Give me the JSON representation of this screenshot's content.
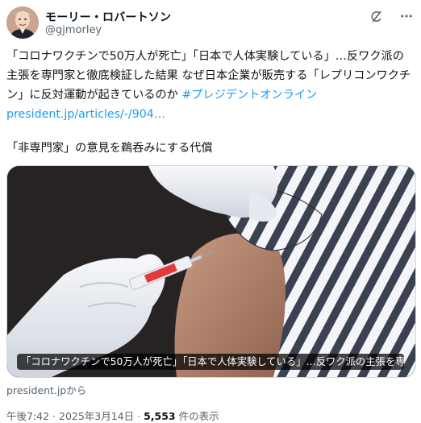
{
  "author": {
    "name": "モーリー・ロバートソン",
    "handle": "@gjmorley"
  },
  "tweet": {
    "text": "「コロナワクチンで50万人が死亡」「日本で人体実験している」…反ワク派の主張を専門家と徹底検証した結果 なぜ日本企業が販売する「レプリコンワクチン」に反対運動が起きているのか ",
    "hashtag": "#プレジデントオンライン",
    "url": "president.jp/articles/-/904…",
    "subhead": "「非専門家」の意見を鵜呑みにする代償"
  },
  "card": {
    "caption": "「コロナワクチンで50万人が死亡」「日本で人体実験している」…反ワク派の主張を専門家…",
    "source": "president.jpから"
  },
  "meta": {
    "time": "午後7:42",
    "sep1": " · ",
    "date": "2025年3月14日",
    "sep2": " · ",
    "views": "5,553",
    "views_label": " 件の表示"
  },
  "icons": {
    "grok": "grok-icon",
    "more": "more-icon"
  },
  "colors": {
    "link": "#1d9bf0",
    "muted": "#536471",
    "text": "#0f1419"
  }
}
